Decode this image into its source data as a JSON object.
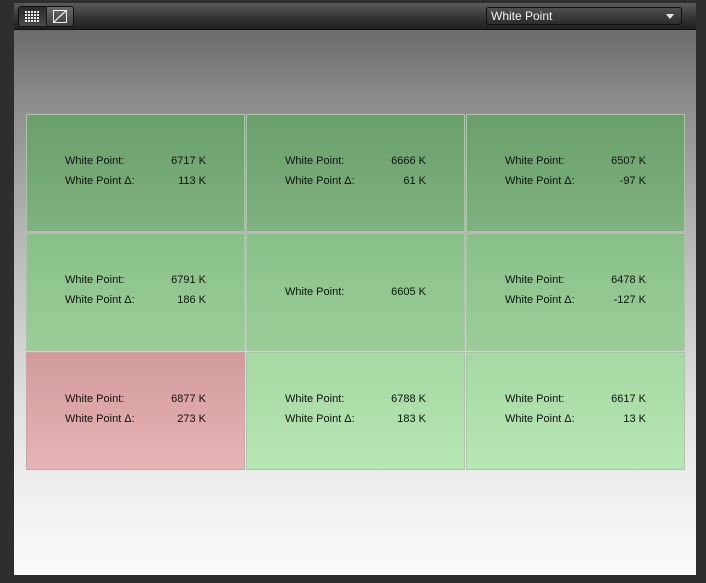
{
  "toolbar": {
    "view_buttons": [
      {
        "icon": "grid-icon",
        "active": true
      },
      {
        "icon": "curve-icon",
        "active": false
      }
    ],
    "metric_select": {
      "value": "White Point"
    }
  },
  "cells": [
    {
      "row": 0,
      "col": 0,
      "status": "ok",
      "white_point_label": "White Point:",
      "white_point": "6717 K",
      "delta_label": "White Point Δ:",
      "delta": "113 K"
    },
    {
      "row": 0,
      "col": 1,
      "status": "ok",
      "white_point_label": "White Point:",
      "white_point": "6666 K",
      "delta_label": "White Point Δ:",
      "delta": "61 K"
    },
    {
      "row": 0,
      "col": 2,
      "status": "ok",
      "white_point_label": "White Point:",
      "white_point": "6507 K",
      "delta_label": "White Point Δ:",
      "delta": "-97 K"
    },
    {
      "row": 1,
      "col": 0,
      "status": "ok",
      "white_point_label": "White Point:",
      "white_point": "6791 K",
      "delta_label": "White Point Δ:",
      "delta": "186 K"
    },
    {
      "row": 1,
      "col": 1,
      "status": "reference",
      "white_point_label": "White Point:",
      "white_point": "6605 K"
    },
    {
      "row": 1,
      "col": 2,
      "status": "ok",
      "white_point_label": "White Point:",
      "white_point": "6478 K",
      "delta_label": "White Point Δ:",
      "delta": "-127 K"
    },
    {
      "row": 2,
      "col": 0,
      "status": "fail",
      "white_point_label": "White Point:",
      "white_point": "6877 K",
      "delta_label": "White Point Δ:",
      "delta": "273 K"
    },
    {
      "row": 2,
      "col": 1,
      "status": "ok",
      "white_point_label": "White Point:",
      "white_point": "6788 K",
      "delta_label": "White Point Δ:",
      "delta": "183 K"
    },
    {
      "row": 2,
      "col": 2,
      "status": "ok",
      "white_point_label": "White Point:",
      "white_point": "6617 K",
      "delta_label": "White Point Δ:",
      "delta": "13 K"
    }
  ],
  "colors": {
    "ok_dark": "#6a9e6b",
    "ok_light": "#b7e7b4",
    "fail": "#e0aeb0"
  }
}
